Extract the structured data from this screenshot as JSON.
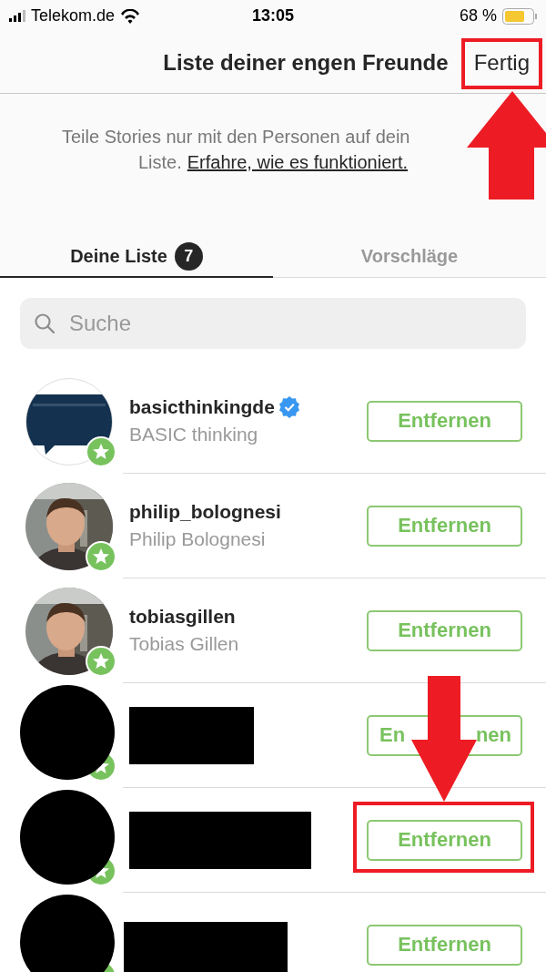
{
  "status_bar": {
    "carrier": "Telekom.de",
    "time": "13:05",
    "battery": "68 %"
  },
  "nav": {
    "title": "Liste deiner engen Freunde",
    "done_button": {
      "label": "Fertig",
      "highlighted": true
    }
  },
  "info": {
    "text": "Teile Stories nur mit den Personen auf dein",
    "text_2": "Liste.",
    "link": "Erfahre, wie es funktioniert."
  },
  "tabs": [
    {
      "label": "Deine Liste",
      "count": "7",
      "selected": true
    },
    {
      "label": "Vorschläge",
      "selected": false
    }
  ],
  "search": {
    "placeholder": "Suche"
  },
  "rows": [
    {
      "kind": "user",
      "username": "basicthinkingde",
      "verified": true,
      "full_name": "BASIC thinking",
      "button": "Entfernen",
      "highlighted": false
    },
    {
      "kind": "user",
      "username": "philip_bolognesi",
      "verified": false,
      "full_name": "Philip Bolognesi",
      "button": "Entfernen",
      "highlighted": false
    },
    {
      "kind": "user",
      "username": "tobiasgillen",
      "verified": false,
      "full_name": "Tobias Gillen",
      "button": "Entfernen",
      "highlighted": false
    },
    {
      "kind": "redacted",
      "button_parts": [
        "En",
        "nen"
      ],
      "highlighted": false
    },
    {
      "kind": "redacted",
      "button": "Entfernen",
      "highlighted": true
    },
    {
      "kind": "redacted",
      "button": "Entfernen",
      "highlighted": false
    }
  ]
}
